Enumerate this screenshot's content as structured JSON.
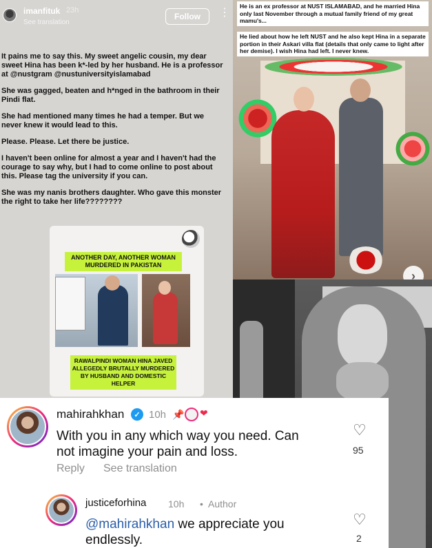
{
  "story": {
    "username": "imanfituk",
    "time": "23h",
    "see_translation": "See translation",
    "follow_label": "Follow",
    "more_icon": "⋮",
    "paragraphs": [
      "It pains me to say this. My sweet angelic cousin, my dear sweet Hina has been k*-led by her husband. He is a professor at @nustgram @nustuniversityislamabad",
      "She was gagged, beaten and h*nged in the bathroom in their Pindi flat.",
      "She had mentioned many times he had a temper. But we never knew it would lead to this.",
      "Please. Please. Let there be justice.",
      "I haven't been online for almost a year and I haven't had the courage to say why, but I had to come online to post about this. Please tag the university if you can.",
      "She was my nanis brothers daughter. Who gave this monster the right to take her life????????"
    ],
    "news": {
      "headline": "ANOTHER DAY, ANOTHER WOMAN MURDERED IN PAKISTAN",
      "caption": "RAWALPINDI WOMAN HINA JAVED ALLEGEDLY BRUTALLY MURDERED BY HUSBAND AND DOMESTIC HELPER"
    }
  },
  "photo_top": {
    "caption1": "He is an ex professor at NUST ISLAMABAD, and he married Hina only last November through a mutual family friend of my great mamu's...",
    "caption2": "He lied about how he left NUST and he also kept Hina in a separate portion in their Askari villa flat (details that only came to light after her demise). I wish Hina had left. I never knew.",
    "next_icon": "›"
  },
  "comments": [
    {
      "username": "mahirahkhan",
      "verified_icon": "✓",
      "time": "10h",
      "pin_icon": "📌",
      "heart_icon": "❤",
      "text": "With you in any which way you need. Can not imagine your pain and loss.",
      "reply_label": "Reply",
      "translate_label": "See translation",
      "like_icon": "♡",
      "likes": "95"
    },
    {
      "username": "justiceforhina",
      "time": "10h",
      "dot": "•",
      "author_label": "Author",
      "mention": "@mahirahkhan",
      "text": " we appreciate you endlessly.",
      "like_icon": "♡",
      "likes": "2"
    }
  ]
}
